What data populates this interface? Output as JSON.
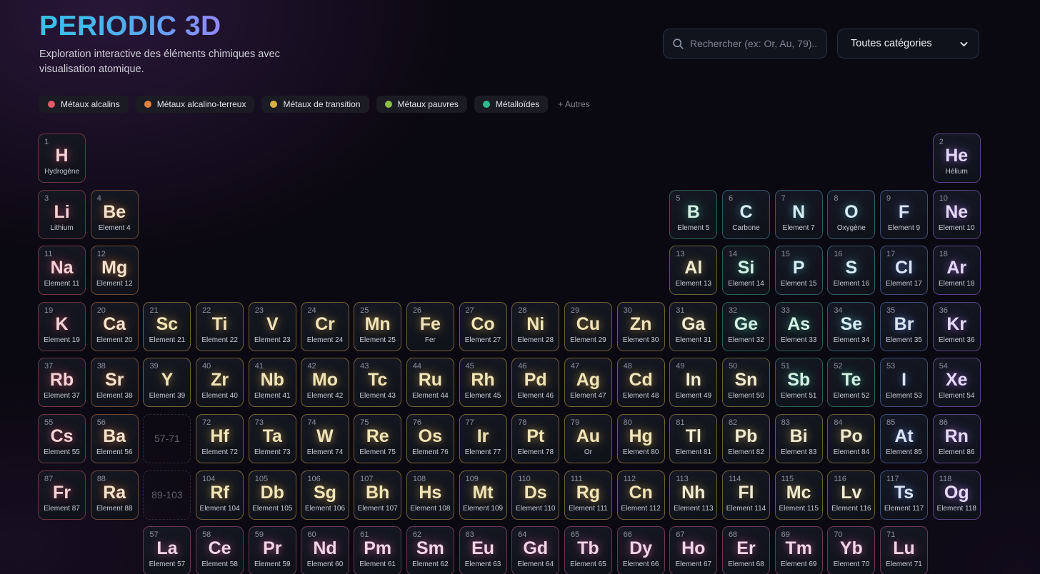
{
  "header": {
    "title": "PERIODIC 3D",
    "subtitle": "Exploration interactive des éléments chimiques avec visualisation atomique.",
    "search_placeholder": "Rechercher (ex: Or, Au, 79)...",
    "category_select_value": "Toutes catégories"
  },
  "legend": {
    "items": [
      {
        "label": "Métaux alcalins",
        "color": "#e15a68"
      },
      {
        "label": "Métaux alcalino-terreux",
        "color": "#e0813c"
      },
      {
        "label": "Métaux de transition",
        "color": "#d9b23f"
      },
      {
        "label": "Métaux pauvres",
        "color": "#8cc044"
      },
      {
        "label": "Métalloïdes",
        "color": "#2fb98d"
      }
    ],
    "more_label": "+ Autres"
  },
  "category_styles": {
    "alkali": {
      "border": "rgba(200,85,100,0.50)",
      "symbol": "#f4d2d6",
      "glow": "rgba(230,90,110,0.45)"
    },
    "alkaline": {
      "border": "rgba(205,125,70,0.50)",
      "symbol": "#f5e3cd",
      "glow": "rgba(230,140,70,0.45)"
    },
    "transition": {
      "border": "rgba(195,158,72,0.55)",
      "symbol": "#f1e4b8",
      "glow": "rgba(220,180,80,0.45)"
    },
    "poor": {
      "border": "rgba(190,165,82,0.50)",
      "symbol": "#f0ead0",
      "glow": "rgba(210,185,95,0.40)"
    },
    "metalloid": {
      "border": "rgba(70,170,135,0.50)",
      "symbol": "#d5f0e4",
      "glow": "rgba(70,200,160,0.45)"
    },
    "nonmetal": {
      "border": "rgba(80,160,185,0.50)",
      "symbol": "#d8eef4",
      "glow": "rgba(90,190,210,0.45)"
    },
    "halogen": {
      "border": "rgba(105,135,210,0.50)",
      "symbol": "#d9e3f6",
      "glow": "rgba(110,150,240,0.45)"
    },
    "noble": {
      "border": "rgba(150,105,215,0.55)",
      "symbol": "#e6d9f6",
      "glow": "rgba(170,120,240,0.45)"
    },
    "lanthanide": {
      "border": "rgba(210,100,160,0.45)",
      "symbol": "#f2d4e6",
      "glow": "rgba(230,110,175,0.45)"
    }
  },
  "placeholders": [
    {
      "label": "57-71",
      "row": 6,
      "col": 3
    },
    {
      "label": "89-103",
      "row": 7,
      "col": 3
    }
  ],
  "elements": [
    [
      1,
      "H",
      "Hydrogène",
      "alkali",
      1,
      1
    ],
    [
      2,
      "He",
      "Hélium",
      "noble",
      1,
      18
    ],
    [
      3,
      "Li",
      "Lithium",
      "alkali",
      2,
      1
    ],
    [
      4,
      "Be",
      "Element 4",
      "alkaline",
      2,
      2
    ],
    [
      5,
      "B",
      "Element 5",
      "metalloid",
      2,
      13
    ],
    [
      6,
      "C",
      "Carbone",
      "nonmetal",
      2,
      14
    ],
    [
      7,
      "N",
      "Element 7",
      "nonmetal",
      2,
      15
    ],
    [
      8,
      "O",
      "Oxygène",
      "nonmetal",
      2,
      16
    ],
    [
      9,
      "F",
      "Element 9",
      "halogen",
      2,
      17
    ],
    [
      10,
      "Ne",
      "Element 10",
      "noble",
      2,
      18
    ],
    [
      11,
      "Na",
      "Element 11",
      "alkali",
      3,
      1
    ],
    [
      12,
      "Mg",
      "Element 12",
      "alkaline",
      3,
      2
    ],
    [
      13,
      "Al",
      "Element 13",
      "poor",
      3,
      13
    ],
    [
      14,
      "Si",
      "Element 14",
      "metalloid",
      3,
      14
    ],
    [
      15,
      "P",
      "Element 15",
      "nonmetal",
      3,
      15
    ],
    [
      16,
      "S",
      "Element 16",
      "nonmetal",
      3,
      16
    ],
    [
      17,
      "Cl",
      "Element 17",
      "halogen",
      3,
      17
    ],
    [
      18,
      "Ar",
      "Element 18",
      "noble",
      3,
      18
    ],
    [
      19,
      "K",
      "Element 19",
      "alkali",
      4,
      1
    ],
    [
      20,
      "Ca",
      "Element 20",
      "alkaline",
      4,
      2
    ],
    [
      21,
      "Sc",
      "Element 21",
      "transition",
      4,
      3
    ],
    [
      22,
      "Ti",
      "Element 22",
      "transition",
      4,
      4
    ],
    [
      23,
      "V",
      "Element 23",
      "transition",
      4,
      5
    ],
    [
      24,
      "Cr",
      "Element 24",
      "transition",
      4,
      6
    ],
    [
      25,
      "Mn",
      "Element 25",
      "transition",
      4,
      7
    ],
    [
      26,
      "Fe",
      "Fer",
      "transition",
      4,
      8
    ],
    [
      27,
      "Co",
      "Element 27",
      "transition",
      4,
      9
    ],
    [
      28,
      "Ni",
      "Element 28",
      "transition",
      4,
      10
    ],
    [
      29,
      "Cu",
      "Element 29",
      "transition",
      4,
      11
    ],
    [
      30,
      "Zn",
      "Element 30",
      "transition",
      4,
      12
    ],
    [
      31,
      "Ga",
      "Element 31",
      "poor",
      4,
      13
    ],
    [
      32,
      "Ge",
      "Element 32",
      "metalloid",
      4,
      14
    ],
    [
      33,
      "As",
      "Element 33",
      "metalloid",
      4,
      15
    ],
    [
      34,
      "Se",
      "Element 34",
      "nonmetal",
      4,
      16
    ],
    [
      35,
      "Br",
      "Element 35",
      "halogen",
      4,
      17
    ],
    [
      36,
      "Kr",
      "Element 36",
      "noble",
      4,
      18
    ],
    [
      37,
      "Rb",
      "Element 37",
      "alkali",
      5,
      1
    ],
    [
      38,
      "Sr",
      "Element 38",
      "alkaline",
      5,
      2
    ],
    [
      39,
      "Y",
      "Element 39",
      "transition",
      5,
      3
    ],
    [
      40,
      "Zr",
      "Element 40",
      "transition",
      5,
      4
    ],
    [
      41,
      "Nb",
      "Element 41",
      "transition",
      5,
      5
    ],
    [
      42,
      "Mo",
      "Element 42",
      "transition",
      5,
      6
    ],
    [
      43,
      "Tc",
      "Element 43",
      "transition",
      5,
      7
    ],
    [
      44,
      "Ru",
      "Element 44",
      "transition",
      5,
      8
    ],
    [
      45,
      "Rh",
      "Element 45",
      "transition",
      5,
      9
    ],
    [
      46,
      "Pd",
      "Element 46",
      "transition",
      5,
      10
    ],
    [
      47,
      "Ag",
      "Element 47",
      "transition",
      5,
      11
    ],
    [
      48,
      "Cd",
      "Element 48",
      "transition",
      5,
      12
    ],
    [
      49,
      "In",
      "Element 49",
      "poor",
      5,
      13
    ],
    [
      50,
      "Sn",
      "Element 50",
      "poor",
      5,
      14
    ],
    [
      51,
      "Sb",
      "Element 51",
      "metalloid",
      5,
      15
    ],
    [
      52,
      "Te",
      "Element 52",
      "metalloid",
      5,
      16
    ],
    [
      53,
      "I",
      "Element 53",
      "halogen",
      5,
      17
    ],
    [
      54,
      "Xe",
      "Element 54",
      "noble",
      5,
      18
    ],
    [
      55,
      "Cs",
      "Element 55",
      "alkali",
      6,
      1
    ],
    [
      56,
      "Ba",
      "Element 56",
      "alkaline",
      6,
      2
    ],
    [
      72,
      "Hf",
      "Element 72",
      "transition",
      6,
      4
    ],
    [
      73,
      "Ta",
      "Element 73",
      "transition",
      6,
      5
    ],
    [
      74,
      "W",
      "Element 74",
      "transition",
      6,
      6
    ],
    [
      75,
      "Re",
      "Element 75",
      "transition",
      6,
      7
    ],
    [
      76,
      "Os",
      "Element 76",
      "transition",
      6,
      8
    ],
    [
      77,
      "Ir",
      "Element 77",
      "transition",
      6,
      9
    ],
    [
      78,
      "Pt",
      "Element 78",
      "transition",
      6,
      10
    ],
    [
      79,
      "Au",
      "Or",
      "transition",
      6,
      11
    ],
    [
      80,
      "Hg",
      "Element 80",
      "transition",
      6,
      12
    ],
    [
      81,
      "Tl",
      "Element 81",
      "poor",
      6,
      13
    ],
    [
      82,
      "Pb",
      "Element 82",
      "poor",
      6,
      14
    ],
    [
      83,
      "Bi",
      "Element 83",
      "poor",
      6,
      15
    ],
    [
      84,
      "Po",
      "Element 84",
      "poor",
      6,
      16
    ],
    [
      85,
      "At",
      "Element 85",
      "halogen",
      6,
      17
    ],
    [
      86,
      "Rn",
      "Element 86",
      "noble",
      6,
      18
    ],
    [
      87,
      "Fr",
      "Element 87",
      "alkali",
      7,
      1
    ],
    [
      88,
      "Ra",
      "Element 88",
      "alkaline",
      7,
      2
    ],
    [
      104,
      "Rf",
      "Element 104",
      "transition",
      7,
      4
    ],
    [
      105,
      "Db",
      "Element 105",
      "transition",
      7,
      5
    ],
    [
      106,
      "Sg",
      "Element 106",
      "transition",
      7,
      6
    ],
    [
      107,
      "Bh",
      "Element 107",
      "transition",
      7,
      7
    ],
    [
      108,
      "Hs",
      "Element 108",
      "transition",
      7,
      8
    ],
    [
      109,
      "Mt",
      "Element 109",
      "transition",
      7,
      9
    ],
    [
      110,
      "Ds",
      "Element 110",
      "transition",
      7,
      10
    ],
    [
      111,
      "Rg",
      "Element 111",
      "transition",
      7,
      11
    ],
    [
      112,
      "Cn",
      "Element 112",
      "transition",
      7,
      12
    ],
    [
      113,
      "Nh",
      "Element 113",
      "poor",
      7,
      13
    ],
    [
      114,
      "Fl",
      "Element 114",
      "poor",
      7,
      14
    ],
    [
      115,
      "Mc",
      "Element 115",
      "poor",
      7,
      15
    ],
    [
      116,
      "Lv",
      "Element 116",
      "poor",
      7,
      16
    ],
    [
      117,
      "Ts",
      "Element 117",
      "halogen",
      7,
      17
    ],
    [
      118,
      "Og",
      "Element 118",
      "noble",
      7,
      18
    ],
    [
      57,
      "La",
      "Element 57",
      "lanthanide",
      8,
      3
    ],
    [
      58,
      "Ce",
      "Element 58",
      "lanthanide",
      8,
      4
    ],
    [
      59,
      "Pr",
      "Element 59",
      "lanthanide",
      8,
      5
    ],
    [
      60,
      "Nd",
      "Element 60",
      "lanthanide",
      8,
      6
    ],
    [
      61,
      "Pm",
      "Element 61",
      "lanthanide",
      8,
      7
    ],
    [
      62,
      "Sm",
      "Element 62",
      "lanthanide",
      8,
      8
    ],
    [
      63,
      "Eu",
      "Element 63",
      "lanthanide",
      8,
      9
    ],
    [
      64,
      "Gd",
      "Element 64",
      "lanthanide",
      8,
      10
    ],
    [
      65,
      "Tb",
      "Element 65",
      "lanthanide",
      8,
      11
    ],
    [
      66,
      "Dy",
      "Element 66",
      "lanthanide",
      8,
      12
    ],
    [
      67,
      "Ho",
      "Element 67",
      "lanthanide",
      8,
      13
    ],
    [
      68,
      "Er",
      "Element 68",
      "lanthanide",
      8,
      14
    ],
    [
      69,
      "Tm",
      "Element 69",
      "lanthanide",
      8,
      15
    ],
    [
      70,
      "Yb",
      "Element 70",
      "lanthanide",
      8,
      16
    ],
    [
      71,
      "Lu",
      "Element 71",
      "lanthanide",
      8,
      17
    ]
  ]
}
